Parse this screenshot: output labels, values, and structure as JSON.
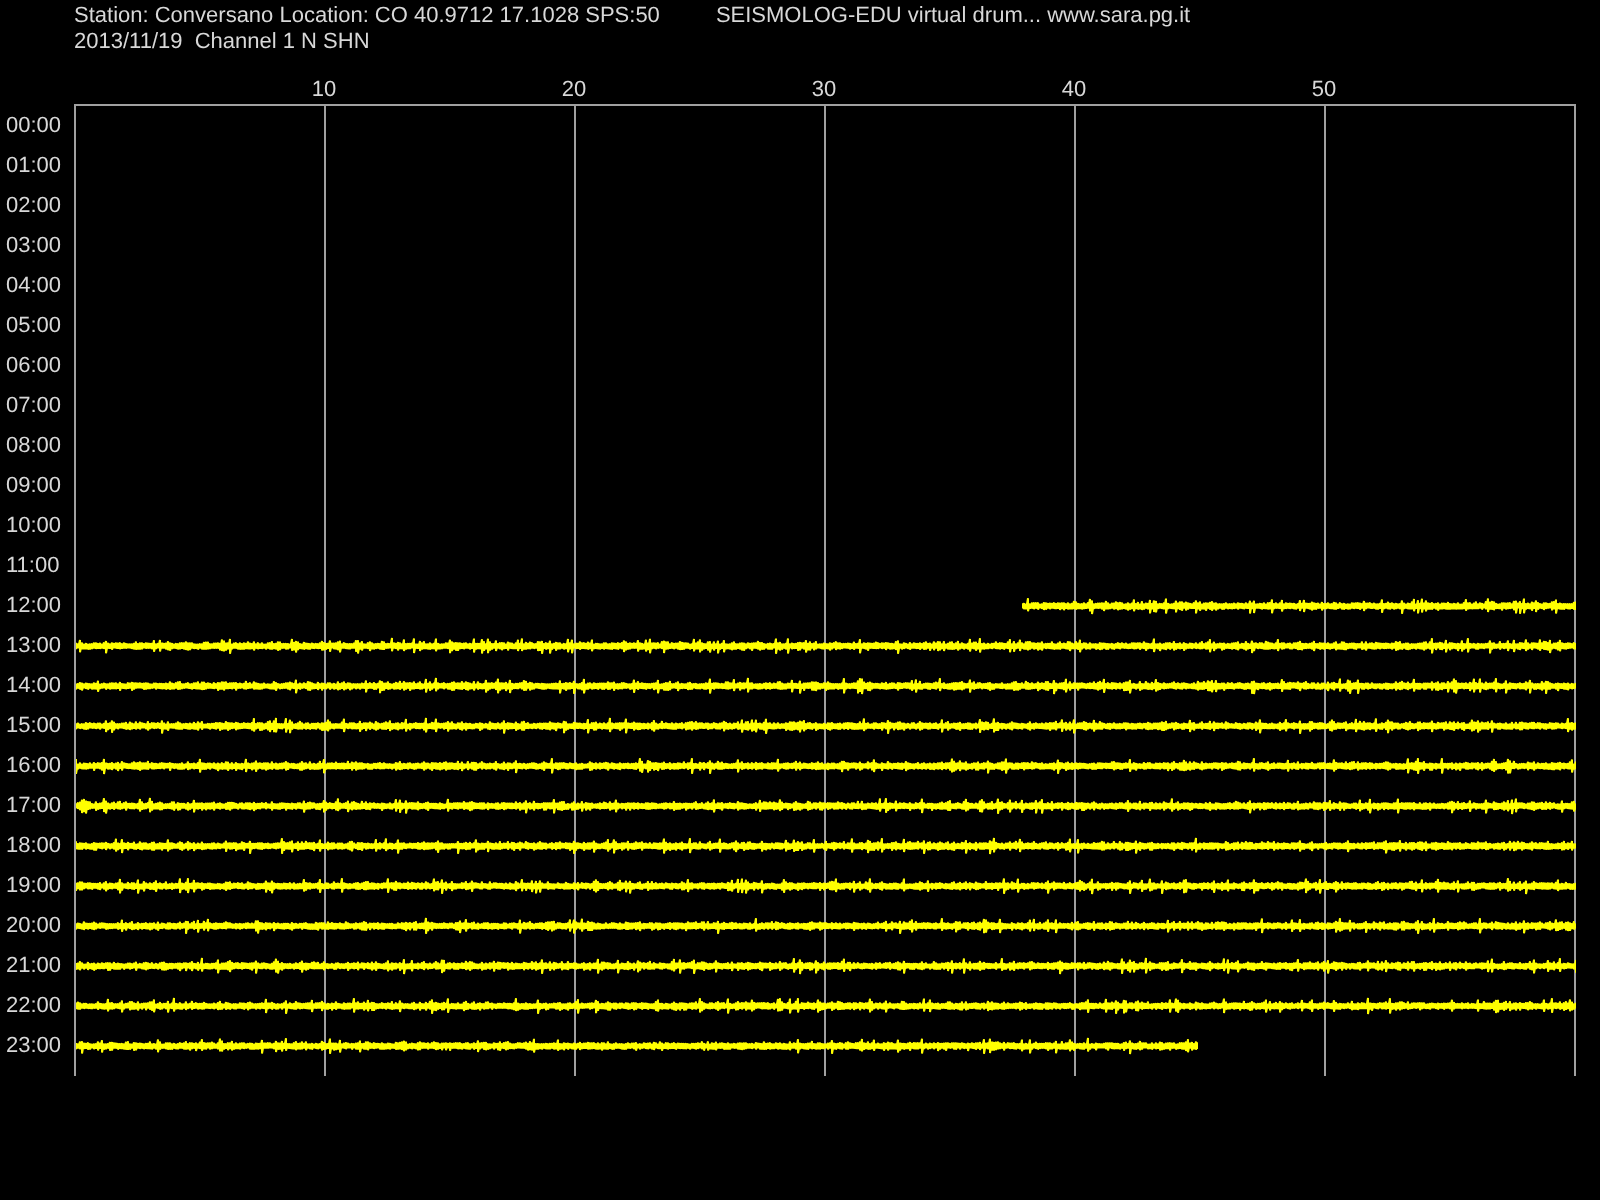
{
  "header": {
    "station": "Station: Conversano Location: CO 40.9712 17.1028 SPS:50",
    "title": "SEISMOLOG-EDU virtual drum... www.sara.pg.it",
    "date_channel": "2013/11/19  Channel 1 N SHN"
  },
  "minute_ticks": [
    "10",
    "20",
    "30",
    "40",
    "50"
  ],
  "rows": [
    {
      "label": "00:00",
      "kind": "empty"
    },
    {
      "label": "01:00",
      "kind": "empty"
    },
    {
      "label": "02:00",
      "kind": "empty"
    },
    {
      "label": "03:00",
      "kind": "empty"
    },
    {
      "label": "04:00",
      "kind": "empty"
    },
    {
      "label": "05:00",
      "kind": "empty"
    },
    {
      "label": "06:00",
      "kind": "empty"
    },
    {
      "label": "07:00",
      "kind": "empty"
    },
    {
      "label": "08:00",
      "kind": "empty"
    },
    {
      "label": "09:00",
      "kind": "empty"
    },
    {
      "label": "10:00",
      "kind": "empty"
    },
    {
      "label": "11:00",
      "kind": "empty"
    },
    {
      "label": "12:00",
      "kind": "starts-late"
    },
    {
      "label": "13:00",
      "kind": "full"
    },
    {
      "label": "14:00",
      "kind": "full"
    },
    {
      "label": "15:00",
      "kind": "full"
    },
    {
      "label": "16:00",
      "kind": "full"
    },
    {
      "label": "17:00",
      "kind": "full"
    },
    {
      "label": "18:00",
      "kind": "full"
    },
    {
      "label": "19:00",
      "kind": "full"
    },
    {
      "label": "20:00",
      "kind": "full"
    },
    {
      "label": "21:00",
      "kind": "full"
    },
    {
      "label": "22:00",
      "kind": "full"
    },
    {
      "label": "23:00",
      "kind": "ends-early"
    }
  ]
}
